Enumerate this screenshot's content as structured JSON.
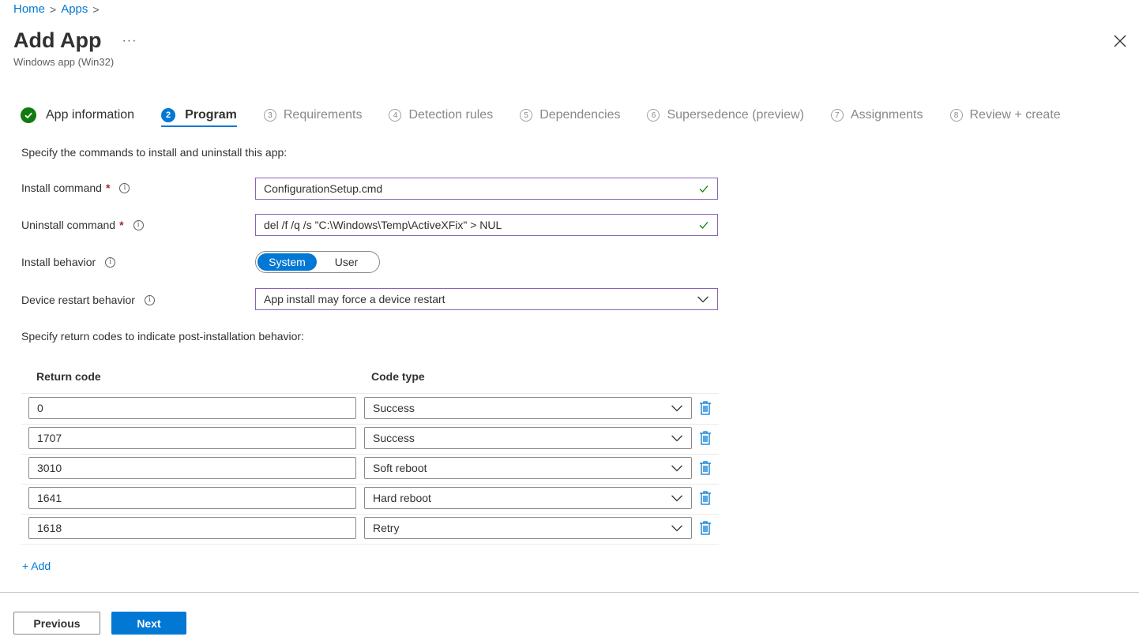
{
  "breadcrumb": {
    "items": [
      "Home",
      "Apps"
    ],
    "separator": ">"
  },
  "header": {
    "title": "Add App",
    "more": "···",
    "subtitle": "Windows app (Win32)"
  },
  "steps": [
    {
      "label": "App information",
      "state": "done"
    },
    {
      "num": "2",
      "label": "Program",
      "state": "active"
    },
    {
      "num": "3",
      "label": "Requirements",
      "state": "pending"
    },
    {
      "num": "4",
      "label": "Detection rules",
      "state": "pending"
    },
    {
      "num": "5",
      "label": "Dependencies",
      "state": "pending"
    },
    {
      "num": "6",
      "label": "Supersedence (preview)",
      "state": "pending"
    },
    {
      "num": "7",
      "label": "Assignments",
      "state": "pending"
    },
    {
      "num": "8",
      "label": "Review + create",
      "state": "pending"
    }
  ],
  "form": {
    "intro": "Specify the commands to install and uninstall this app:",
    "install_label": "Install command",
    "install_value": "ConfigurationSetup.cmd",
    "uninstall_label": "Uninstall command",
    "uninstall_value": "del /f /q /s \"C:\\Windows\\Temp\\ActiveXFix\" > NUL",
    "required_mark": "*",
    "behavior_label": "Install behavior",
    "behavior_options": [
      "System",
      "User"
    ],
    "behavior_selected": "System",
    "restart_label": "Device restart behavior",
    "restart_value": "App install may force a device restart",
    "return_intro": "Specify return codes to indicate post-installation behavior:"
  },
  "table": {
    "headers": [
      "Return code",
      "Code type"
    ],
    "rows": [
      {
        "code": "0",
        "type": "Success"
      },
      {
        "code": "1707",
        "type": "Success"
      },
      {
        "code": "3010",
        "type": "Soft reboot"
      },
      {
        "code": "1641",
        "type": "Hard reboot"
      },
      {
        "code": "1618",
        "type": "Retry"
      }
    ],
    "add_label": "+ Add"
  },
  "footer": {
    "previous": "Previous",
    "next": "Next"
  },
  "colors": {
    "accent": "#0078d4",
    "success": "#107c10",
    "focus_border": "#8764b8",
    "required": "#a4262c"
  },
  "icons": {
    "close": "close-icon",
    "info": "info-icon",
    "check": "checkmark-icon",
    "chevron": "chevron-down-icon",
    "delete": "trash-icon"
  }
}
